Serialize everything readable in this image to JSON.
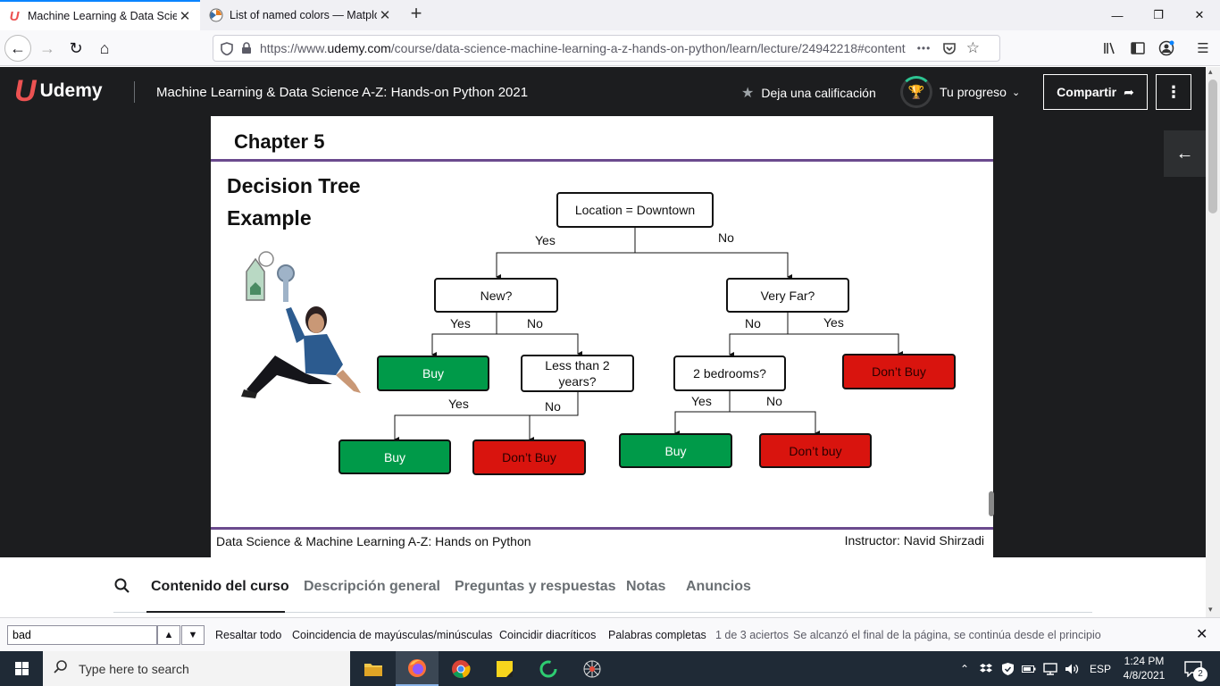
{
  "browser": {
    "tabs": [
      {
        "title": "Machine Learning & Data Scien",
        "icon": "udemy-favicon"
      },
      {
        "title": "List of named colors — Matplo",
        "icon": "matplotlib-favicon"
      }
    ],
    "url_prefix": "https://www.",
    "url_domain": "udemy.com",
    "url_path": "/course/data-science-machine-learning-a-z-hands-on-python/learn/lecture/24942218#content",
    "urlbar_more": "•••"
  },
  "udemy": {
    "logo_text": "Udemy",
    "course_title": "Machine Learning & Data Science A-Z: Hands-on Python 2021",
    "rate_label": "Deja una calificación",
    "progress_label": "Tu progreso",
    "share_label": "Compartir",
    "more_label": "⋮"
  },
  "slide": {
    "chapter": "Chapter 5",
    "title_line1": "Decision Tree",
    "title_line2": "Example",
    "footer_left": "Data Science & Machine Learning A-Z: Hands on Python",
    "footer_right": "Instructor: Navid Shirzadi",
    "tree": {
      "root": "Location = Downtown",
      "root_yes": "Yes",
      "root_no": "No",
      "new": "New?",
      "new_yes": "Yes",
      "new_no": "No",
      "veryfar": "Very Far?",
      "veryfar_no": "No",
      "veryfar_yes": "Yes",
      "buy1": "Buy",
      "less2": "Less than 2 years?",
      "bedrooms": "2 bedrooms?",
      "dontbuy1": "Don’t Buy",
      "less2_yes": "Yes",
      "less2_no": "No",
      "bed_yes": "Yes",
      "bed_no": "No",
      "buy2": "Buy",
      "dontbuy2": "Don’t Buy",
      "buy3": "Buy",
      "dontbuy3": "Don’t buy"
    }
  },
  "course_tabs": [
    "Contenido del curso",
    "Descripción general",
    "Preguntas y respuestas",
    "Notas",
    "Anuncios"
  ],
  "findbar": {
    "query": "bad",
    "highlight_all": "Resaltar todo",
    "match_case": "Coincidencia de mayúsculas/minúsculas",
    "match_diacritics": "Coincidir diacríticos",
    "whole_words": "Palabras completas",
    "count": "1 de 3 aciertos",
    "wrap_notice": "Se alcanzó el final de la página, se continúa desde el principio"
  },
  "taskbar": {
    "search_placeholder": "Type here to search",
    "lang": "ESP",
    "time": "1:24 PM",
    "date": "4/8/2021",
    "notifications": "2"
  },
  "colors": {
    "udemy_dark": "#1c1d1f",
    "udemy_red": "#ec5252",
    "buy_green": "#009a49",
    "dontbuy_red": "#d9140e",
    "slide_rule": "#6b4a8e"
  }
}
